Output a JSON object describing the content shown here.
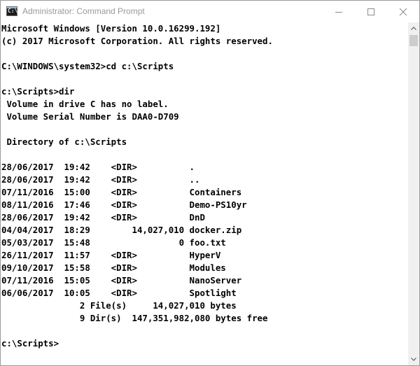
{
  "window": {
    "title": "Administrator: Command Prompt",
    "icon": "cmd-icon",
    "icon_glyph": "C:\\"
  },
  "controls": {
    "minimize_icon": "minimize-icon",
    "maximize_icon": "maximize-icon",
    "close_icon": "close-icon"
  },
  "console": {
    "lines": [
      "Microsoft Windows [Version 10.0.16299.192]",
      "(c) 2017 Microsoft Corporation. All rights reserved.",
      "",
      "C:\\WINDOWS\\system32>cd c:\\Scripts",
      "",
      "c:\\Scripts>dir",
      " Volume in drive C has no label.",
      " Volume Serial Number is DAA0-D709",
      "",
      " Directory of c:\\Scripts",
      "",
      "28/06/2017  19:42    <DIR>          .",
      "28/06/2017  19:42    <DIR>          ..",
      "07/11/2016  15:00    <DIR>          Containers",
      "08/11/2016  17:46    <DIR>          Demo-PS10yr",
      "28/06/2017  19:42    <DIR>          DnD",
      "04/04/2017  18:29        14,027,010 docker.zip",
      "05/03/2017  15:48                 0 foo.txt",
      "26/11/2017  11:57    <DIR>          HyperV",
      "09/10/2017  15:58    <DIR>          Modules",
      "07/11/2016  15:05    <DIR>          NanoServer",
      "06/06/2017  10:05    <DIR>          Spotlight",
      "               2 File(s)     14,027,010 bytes",
      "               9 Dir(s)  147,351,982,080 bytes free",
      "",
      "c:\\Scripts>"
    ]
  },
  "colors": {
    "background": "#ffffff",
    "text": "#000000",
    "title_text": "#9a9a9a",
    "scrollbar_track": "#f0f0f0",
    "scrollbar_thumb": "#cdcdcd"
  }
}
